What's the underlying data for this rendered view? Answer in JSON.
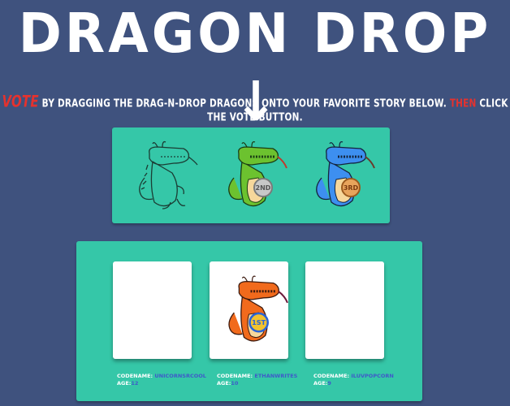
{
  "header": {
    "title": "DRAGON DROP",
    "arrow": "↓"
  },
  "instructions": {
    "vote": "VOTE",
    "middle": " BY DRAGGING THE DRAG-N-DROP DRAGONS ONTO YOUR FAVORITE STORY BELOW. ",
    "then": "THEN",
    "end": " CLICK THE VOTE BUTTON."
  },
  "dragons": [
    {
      "name": "empty outline dragon",
      "color": "#35c7a8",
      "badge": ""
    },
    {
      "name": "green dragon",
      "color": "#6cc22f",
      "badge": "2ND"
    },
    {
      "name": "blue dragon",
      "color": "#3d8ff0",
      "badge": "3RD"
    }
  ],
  "stories": [
    {
      "codename_label": "CODENAME:",
      "codename": "UNICORNSRCOOL",
      "age_label": "AGE:",
      "age": "12"
    },
    {
      "codename_label": "CODENAME:",
      "codename": "ETHANWRITES",
      "age_label": "AGE:",
      "age": "10"
    },
    {
      "codename_label": "CODENAME:",
      "codename": "ILUVPOPCORN",
      "age_label": "AGE:",
      "age": "9"
    }
  ],
  "placed_dragon": {
    "name": "orange dragon",
    "color": "#f16a1c",
    "badge": "1ST"
  }
}
